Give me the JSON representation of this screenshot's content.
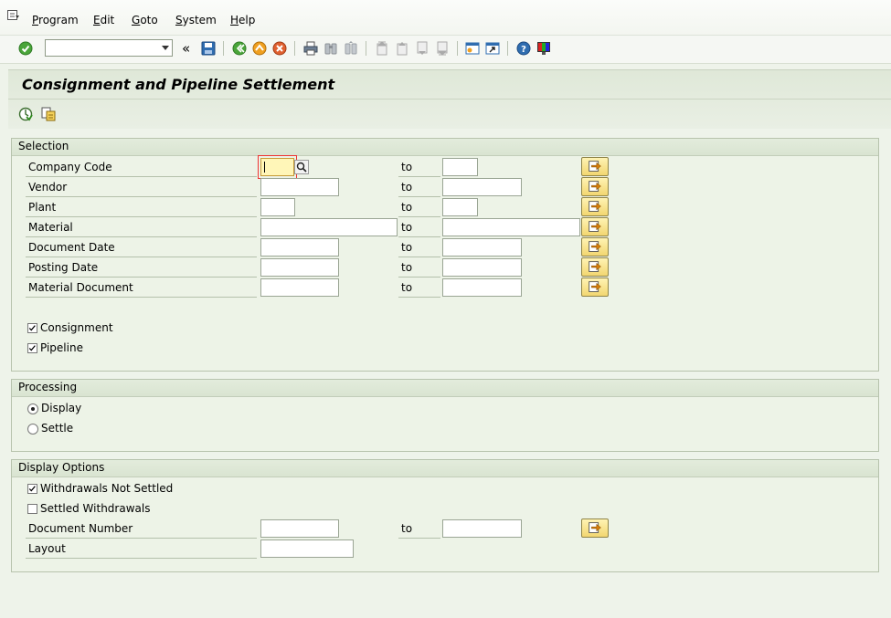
{
  "menu": {
    "items": [
      {
        "label": "Program",
        "mnemonic": "P",
        "rest": "rogram"
      },
      {
        "label": "Edit",
        "mnemonic": "E",
        "rest": "dit"
      },
      {
        "label": "Goto",
        "mnemonic": "G",
        "rest": "oto"
      },
      {
        "label": "System",
        "mnemonic": "S",
        "rest": "ystem"
      },
      {
        "label": "Help",
        "mnemonic": "H",
        "rest": "elp"
      }
    ]
  },
  "toolbar": {
    "command_field_value": "",
    "back_chevron": "«",
    "icons": [
      "enter-icon",
      "save-icon",
      "back-icon",
      "exit-icon",
      "cancel-icon",
      "print-icon",
      "find-icon",
      "find-next-icon",
      "first-page-icon",
      "previous-page-icon",
      "next-page-icon",
      "last-page-icon",
      "create-session-icon",
      "shortcut-icon",
      "help-icon",
      "layout-icon"
    ]
  },
  "page": {
    "title": "Consignment and Pipeline Settlement",
    "app_toolbar_icons": [
      "execute-icon",
      "get-variant-icon"
    ]
  },
  "selection": {
    "title": "Selection",
    "to_label": "to",
    "rows": [
      {
        "label": "Company Code",
        "from": "",
        "to": ""
      },
      {
        "label": "Vendor",
        "from": "",
        "to": ""
      },
      {
        "label": "Plant",
        "from": "",
        "to": ""
      },
      {
        "label": "Material",
        "from": "",
        "to": ""
      },
      {
        "label": "Document Date",
        "from": "",
        "to": ""
      },
      {
        "label": "Posting Date",
        "from": "",
        "to": ""
      },
      {
        "label": "Material Document",
        "from": "",
        "to": ""
      }
    ],
    "checkboxes": [
      {
        "label": "Consignment",
        "checked": true
      },
      {
        "label": "Pipeline",
        "checked": true
      }
    ]
  },
  "processing": {
    "title": "Processing",
    "options": [
      {
        "label": "Display",
        "selected": true
      },
      {
        "label": "Settle",
        "selected": false
      }
    ]
  },
  "display_options": {
    "title": "Display Options",
    "checkboxes": [
      {
        "label": "Withdrawals Not Settled",
        "checked": true
      },
      {
        "label": "Settled Withdrawals",
        "checked": false
      }
    ],
    "document_number": {
      "label": "Document Number",
      "to_label": "to",
      "from": "",
      "to": ""
    },
    "layout": {
      "label": "Layout",
      "value": ""
    }
  },
  "colors": {
    "background": "#eef3ea",
    "group_header": "#dde7d6",
    "required_field": "#fff6b8",
    "multi_button": "#f2d670"
  }
}
